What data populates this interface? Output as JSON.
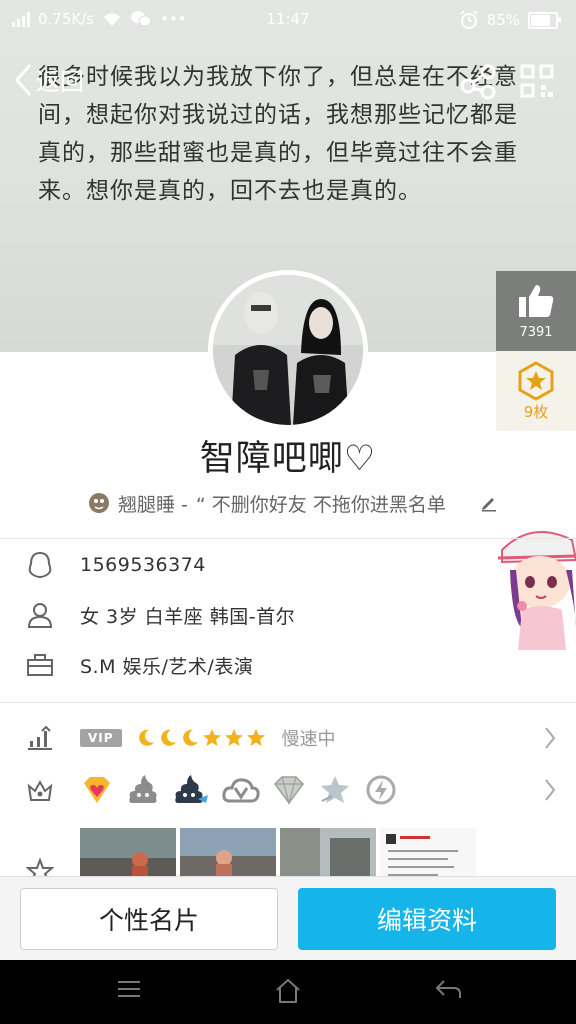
{
  "status_bar": {
    "network_speed": "0.75K/s",
    "more": "•••",
    "time": "11:47",
    "battery": "85%"
  },
  "nav": {
    "back_label": "返回"
  },
  "cover": {
    "quote": "很多时候我以为我放下你了，但总是在不经意间，想起你对我说过的话，我想那些记忆都是真的，那些甜蜜也是真的，但毕竟过往不会重来。想你是真的，回不去也是真的。"
  },
  "side": {
    "like_count": "7391",
    "badge_count": "9枚"
  },
  "profile": {
    "nickname": "智障吧唧♡",
    "signature_name": "翘腿睡 -",
    "signature_text": "“ 不删你好友  不拖你进黑名单"
  },
  "info": {
    "qq_number": "1569536374",
    "basic": "女  3岁  白羊座  韩国-首尔",
    "job": "S.M 娱乐/艺术/表演"
  },
  "level": {
    "vip_label": "VIP",
    "speed_text": "慢速中"
  },
  "buttons": {
    "card": "个性名片",
    "edit": "编辑资料"
  },
  "colors": {
    "accent": "#15b4e9",
    "badge_gold": "#e6a01a",
    "like_bg": "#7b7e7b"
  }
}
